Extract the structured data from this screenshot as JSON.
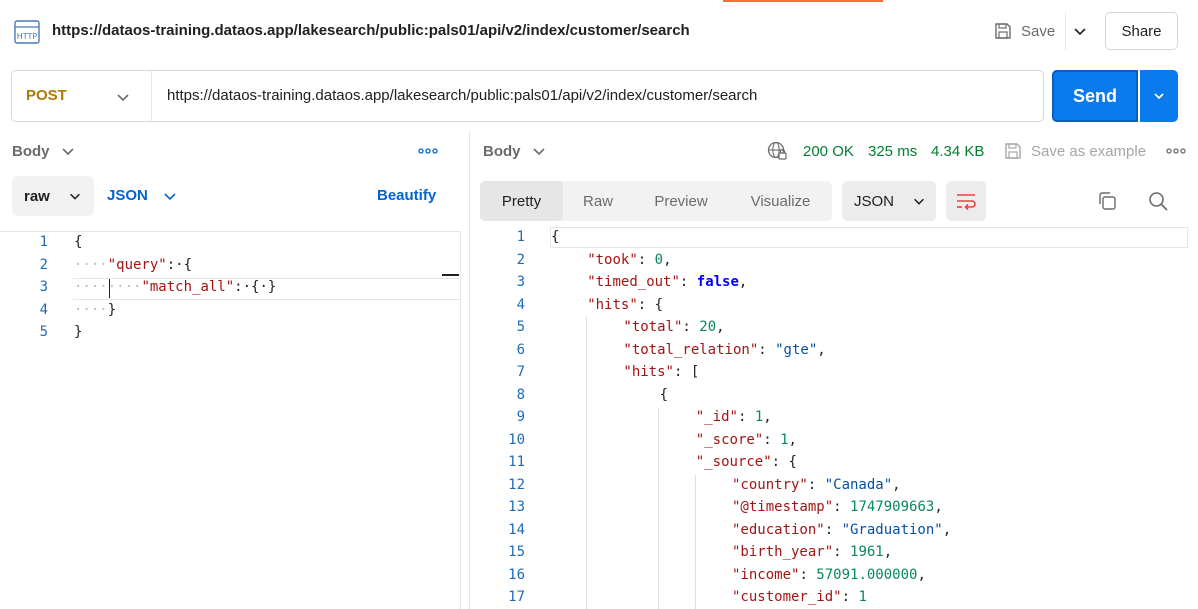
{
  "title_bar": {
    "url": "https://dataos-training.dataos.app/lakesearch/public:pals01/api/v2/index/customer/search",
    "save_label": "Save",
    "share_label": "Share"
  },
  "request": {
    "method": "POST",
    "url": "https://dataos-training.dataos.app/lakesearch/public:pals01/api/v2/index/customer/search",
    "send_label": "Send"
  },
  "request_body": {
    "tab_label": "Body",
    "mode": "raw",
    "language": "JSON",
    "beautify_label": "Beautify",
    "lines": [
      {
        "n": "1",
        "indent": "",
        "parts": [
          {
            "t": "{",
            "c": "p"
          }
        ]
      },
      {
        "n": "2",
        "indent": "····",
        "parts": [
          {
            "t": "\"query\"",
            "c": "key"
          },
          {
            "t": ":·{",
            "c": "p"
          }
        ]
      },
      {
        "n": "3",
        "indent": "········",
        "parts": [
          {
            "t": "\"match_all\"",
            "c": "key"
          },
          {
            "t": ":·{·}",
            "c": "p"
          }
        ]
      },
      {
        "n": "4",
        "indent": "····",
        "parts": [
          {
            "t": "}",
            "c": "p"
          }
        ]
      },
      {
        "n": "5",
        "indent": "",
        "parts": [
          {
            "t": "}",
            "c": "p"
          }
        ]
      }
    ]
  },
  "response": {
    "tab_label": "Body",
    "status": "200 OK",
    "time": "325 ms",
    "size": "4.34 KB",
    "save_example_label": "Save as example",
    "view_tabs": [
      "Pretty",
      "Raw",
      "Preview",
      "Visualize"
    ],
    "active_view": "Pretty",
    "format": "JSON",
    "lines": [
      {
        "n": "1",
        "lvl": 0,
        "parts": [
          {
            "t": "{",
            "c": "p"
          }
        ]
      },
      {
        "n": "2",
        "lvl": 1,
        "parts": [
          {
            "t": "\"took\"",
            "c": "key"
          },
          {
            "t": ": ",
            "c": "p"
          },
          {
            "t": "0",
            "c": "num"
          },
          {
            "t": ",",
            "c": "p"
          }
        ]
      },
      {
        "n": "3",
        "lvl": 1,
        "parts": [
          {
            "t": "\"timed_out\"",
            "c": "key"
          },
          {
            "t": ": ",
            "c": "p"
          },
          {
            "t": "false",
            "c": "bool"
          },
          {
            "t": ",",
            "c": "p"
          }
        ]
      },
      {
        "n": "4",
        "lvl": 1,
        "parts": [
          {
            "t": "\"hits\"",
            "c": "key"
          },
          {
            "t": ": {",
            "c": "p"
          }
        ]
      },
      {
        "n": "5",
        "lvl": 2,
        "parts": [
          {
            "t": "\"total\"",
            "c": "key"
          },
          {
            "t": ": ",
            "c": "p"
          },
          {
            "t": "20",
            "c": "num"
          },
          {
            "t": ",",
            "c": "p"
          }
        ]
      },
      {
        "n": "6",
        "lvl": 2,
        "parts": [
          {
            "t": "\"total_relation\"",
            "c": "key"
          },
          {
            "t": ": ",
            "c": "p"
          },
          {
            "t": "\"gte\"",
            "c": "str"
          },
          {
            "t": ",",
            "c": "p"
          }
        ]
      },
      {
        "n": "7",
        "lvl": 2,
        "parts": [
          {
            "t": "\"hits\"",
            "c": "key"
          },
          {
            "t": ": [",
            "c": "p"
          }
        ]
      },
      {
        "n": "8",
        "lvl": 3,
        "parts": [
          {
            "t": "{",
            "c": "p"
          }
        ]
      },
      {
        "n": "9",
        "lvl": 4,
        "parts": [
          {
            "t": "\"_id\"",
            "c": "key"
          },
          {
            "t": ": ",
            "c": "p"
          },
          {
            "t": "1",
            "c": "num"
          },
          {
            "t": ",",
            "c": "p"
          }
        ]
      },
      {
        "n": "10",
        "lvl": 4,
        "parts": [
          {
            "t": "\"_score\"",
            "c": "key"
          },
          {
            "t": ": ",
            "c": "p"
          },
          {
            "t": "1",
            "c": "num"
          },
          {
            "t": ",",
            "c": "p"
          }
        ]
      },
      {
        "n": "11",
        "lvl": 4,
        "parts": [
          {
            "t": "\"_source\"",
            "c": "key"
          },
          {
            "t": ": {",
            "c": "p"
          }
        ]
      },
      {
        "n": "12",
        "lvl": 5,
        "parts": [
          {
            "t": "\"country\"",
            "c": "key"
          },
          {
            "t": ": ",
            "c": "p"
          },
          {
            "t": "\"Canada\"",
            "c": "str"
          },
          {
            "t": ",",
            "c": "p"
          }
        ]
      },
      {
        "n": "13",
        "lvl": 5,
        "parts": [
          {
            "t": "\"@timestamp\"",
            "c": "key"
          },
          {
            "t": ": ",
            "c": "p"
          },
          {
            "t": "1747909663",
            "c": "num"
          },
          {
            "t": ",",
            "c": "p"
          }
        ]
      },
      {
        "n": "14",
        "lvl": 5,
        "parts": [
          {
            "t": "\"education\"",
            "c": "key"
          },
          {
            "t": ": ",
            "c": "p"
          },
          {
            "t": "\"Graduation\"",
            "c": "str"
          },
          {
            "t": ",",
            "c": "p"
          }
        ]
      },
      {
        "n": "15",
        "lvl": 5,
        "parts": [
          {
            "t": "\"birth_year\"",
            "c": "key"
          },
          {
            "t": ": ",
            "c": "p"
          },
          {
            "t": "1961",
            "c": "num"
          },
          {
            "t": ",",
            "c": "p"
          }
        ]
      },
      {
        "n": "16",
        "lvl": 5,
        "parts": [
          {
            "t": "\"income\"",
            "c": "key"
          },
          {
            "t": ": ",
            "c": "p"
          },
          {
            "t": "57091.000000",
            "c": "num"
          },
          {
            "t": ",",
            "c": "p"
          }
        ]
      },
      {
        "n": "17",
        "lvl": 5,
        "parts": [
          {
            "t": "\"customer_id\"",
            "c": "key"
          },
          {
            "t": ": ",
            "c": "p"
          },
          {
            "t": "1",
            "c": "num"
          }
        ]
      }
    ]
  },
  "colors": {
    "accent": "#ff6c37",
    "send": "#097bed",
    "method": "#ad7a03",
    "status_ok": "#007f31",
    "link": "#0265d2"
  },
  "icons": [
    "http-icon",
    "save-icon",
    "chevron-down-icon",
    "globe-icon",
    "more-icon",
    "wrap-icon",
    "copy-icon",
    "search-icon"
  ]
}
